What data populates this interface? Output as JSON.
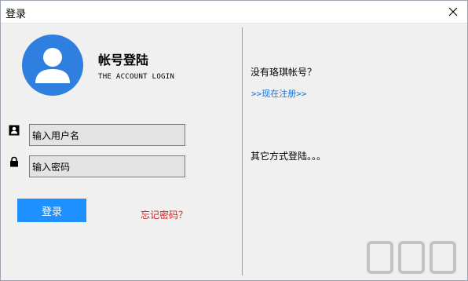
{
  "window": {
    "title": "登录"
  },
  "profile": {
    "heading": "帐号登陆",
    "subheading": "THE ACCOUNT LOGIN"
  },
  "form": {
    "username_placeholder": "输入用户名",
    "password_placeholder": "输入密码",
    "login_label": "登录",
    "forgot_label": "忘记密码？"
  },
  "side": {
    "no_account": "没有珞琪帐号？",
    "register_link": ">>现在注册>>",
    "other_methods": "其它方式登陆。。。"
  },
  "colors": {
    "accent": "#1e90ff",
    "avatar": "#2f7fe0",
    "forgot": "#d02020",
    "link": "#1a6fd6"
  },
  "icons": [
    "close-icon",
    "user-avatar-icon",
    "user-icon",
    "lock-icon"
  ]
}
